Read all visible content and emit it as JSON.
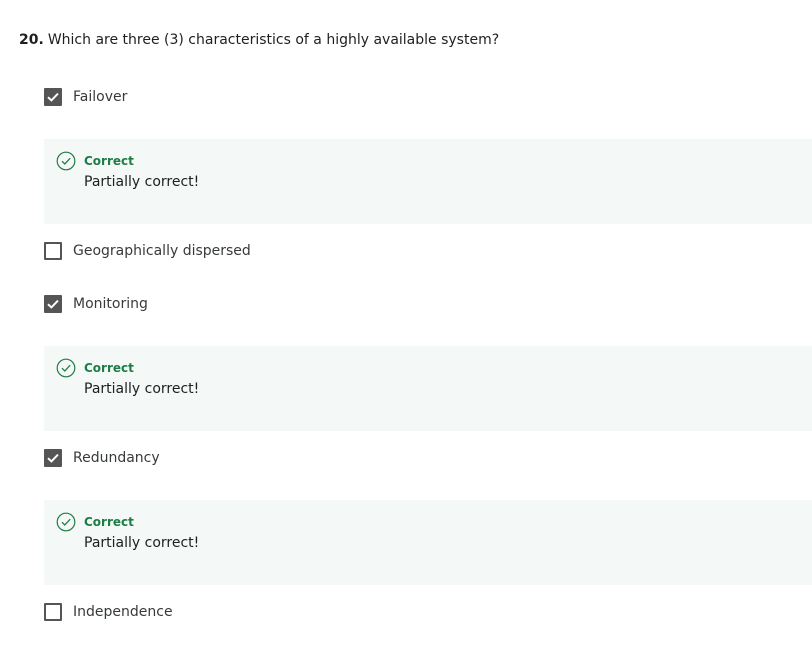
{
  "question": {
    "number": "20.",
    "text": "Which are three (3) characteristics of a highly available system?"
  },
  "options": [
    {
      "label": "Failover",
      "checked": true
    },
    {
      "label": "Geographically dispersed",
      "checked": false
    },
    {
      "label": "Monitoring",
      "checked": true
    },
    {
      "label": "Redundancy",
      "checked": true
    },
    {
      "label": "Independence",
      "checked": false
    }
  ],
  "feedback": [
    {
      "title": "Correct",
      "message": "Partially correct!"
    },
    {
      "title": "Correct",
      "message": "Partially correct!"
    },
    {
      "title": "Correct",
      "message": "Partially correct!"
    }
  ],
  "colors": {
    "correct_green": "#1e7d46",
    "feedback_bg": "#f4f8f7",
    "checkbox_fill": "#555555"
  },
  "icons": {
    "checkmark": "check-icon",
    "feedback": "circle-check-icon"
  }
}
